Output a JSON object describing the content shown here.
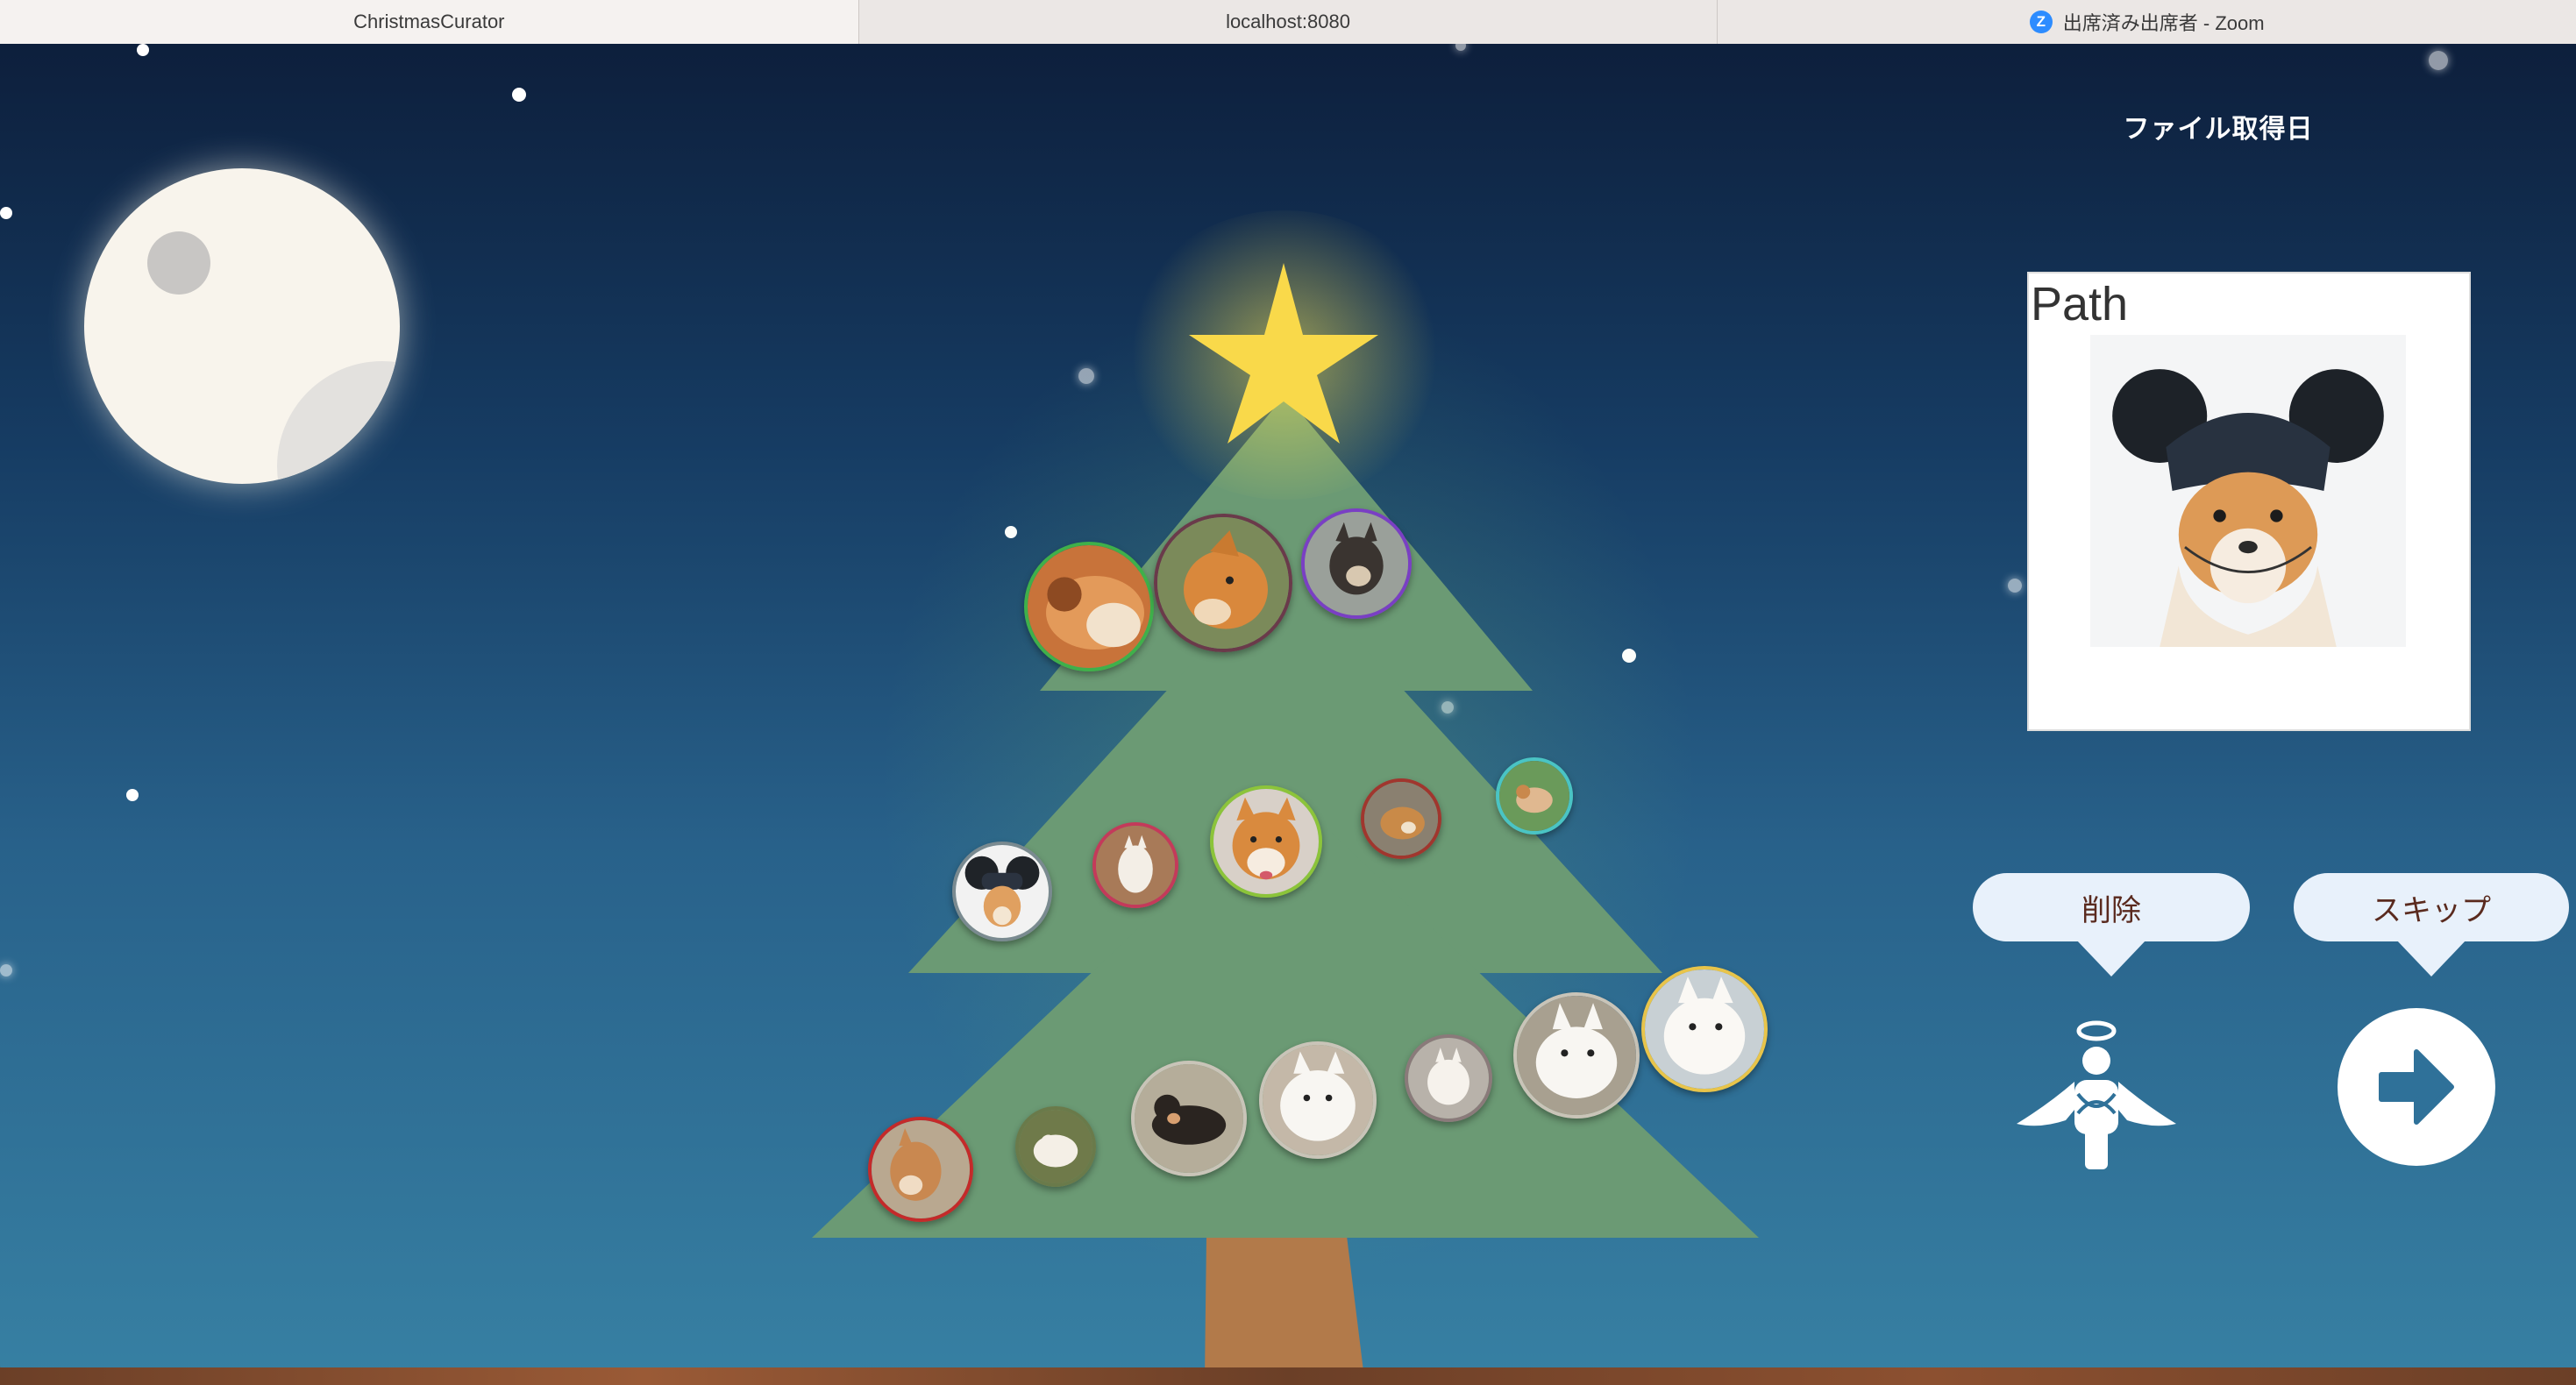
{
  "browser": {
    "tabs": [
      {
        "title": "ChristmasCurator",
        "active": true
      },
      {
        "title": "localhost:8080",
        "active": false
      },
      {
        "title": "出席済み出席者 - Zoom",
        "active": false,
        "icon": "zoom-icon"
      }
    ]
  },
  "panel": {
    "title": "ファイル取得日",
    "preview_label": "Path",
    "delete_label": "削除",
    "skip_label": "スキップ"
  },
  "icons": {
    "delete": "angel-icon",
    "skip": "arrow-right-icon"
  },
  "colors": {
    "sky_top": "#0d1f3c",
    "sky_bottom": "#3780a3",
    "tree": "#6b9a74",
    "star": "#f9d94a",
    "trunk": "#b27a4a",
    "bubble": "#e8f1fb",
    "bubble_text": "#5a2a1e"
  }
}
